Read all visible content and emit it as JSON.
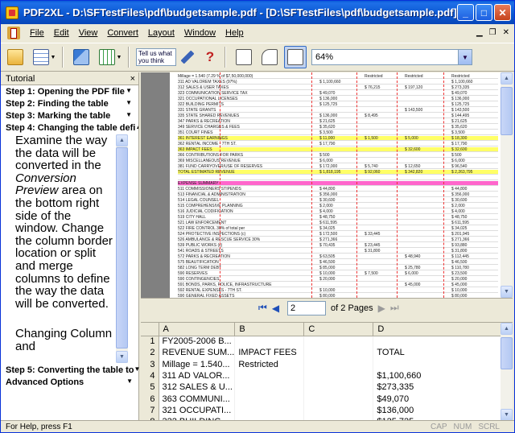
{
  "window": {
    "title": "PDF2XL - D:\\SFTestFiles\\pdf\\budgetsample.pdf - [D:\\SFTestFiles\\pdf\\budgetsample.pdf]"
  },
  "menu": {
    "items": [
      "File",
      "Edit",
      "View",
      "Convert",
      "Layout",
      "Window",
      "Help"
    ]
  },
  "toolbar": {
    "tell_me": "Tell us what you think",
    "zoom": "64%"
  },
  "tutorial": {
    "header": "Tutorial",
    "close": "×",
    "steps_top": [
      "Step 1: Opening the PDF file",
      "Step 2: Finding the table",
      "Step 3: Marking the table",
      "Step 4: Changing the table defi"
    ],
    "body_pre": "Examine the way the data will be converted in the",
    "body_em": "Conversion Preview",
    "body_post": "area on the bottom right side of the window. Change the column border location or split and merge columns to define the way the data will be converted.",
    "subheading": "Changing Column and",
    "steps_bottom": [
      "Step 5: Converting the table to",
      "Advanced Options"
    ]
  },
  "pdf": {
    "rows": [
      {
        "label": "Millage = 1.540 (7.29 % of $7,50,000,000)",
        "v1": "",
        "v2": "Restricted",
        "v3": "Restricted",
        "v4": "Restricted"
      },
      {
        "label": "311 AD VALOREM TAXES (97%)",
        "v1": "$ 1,100,660",
        "v2": "",
        "v3": "",
        "v4": "$ 1,100,660"
      },
      {
        "label": "312 SALES & USER TAXES",
        "v1": "",
        "v2": "$ 76,215",
        "v3": "$ 197,120",
        "v4": "$ 273,335"
      },
      {
        "label": "323 COMMUNICATION SERVICE TAX",
        "v1": "$ 49,070",
        "v2": "",
        "v3": "",
        "v4": "$ 49,070"
      },
      {
        "label": "321 OCCUPATIONAL LICENSES",
        "v1": "$ 136,000",
        "v2": "",
        "v3": "",
        "v4": "$ 136,000"
      },
      {
        "label": "322 BUILDING PERMITS",
        "v1": "$ 125,725",
        "v2": "",
        "v3": "",
        "v4": "$ 125,725"
      },
      {
        "label": "331 STATE GRANTS",
        "v1": "",
        "v2": "",
        "v3": "$ 143,500",
        "v4": "$ 143,500"
      },
      {
        "label": "335 STATE SHARED REVENUES",
        "v1": "$ 136,000",
        "v2": "$ 8,495",
        "v3": "",
        "v4": "$ 144,495"
      },
      {
        "label": "347 PARKS & RECREATION",
        "v1": "$ 21,625",
        "v2": "",
        "v3": "",
        "v4": "$ 21,625"
      },
      {
        "label": "349 SERVICE CHARGES & FEES",
        "v1": "$ 35,620",
        "v2": "",
        "v3": "",
        "v4": "$ 35,620"
      },
      {
        "label": "351 COURT FINES",
        "v1": "$ 3,500",
        "v2": "",
        "v3": "",
        "v4": "$ 3,500"
      },
      {
        "label": "361 INTEREST EARNINGS",
        "v1": "$ 11,000",
        "v2": "$ 1,500",
        "v3": "$ 5,000",
        "v4": "$ 18,300"
      },
      {
        "label": "362 RENTAL INCOME - 7TH ST.",
        "v1": "$ 17,790",
        "v2": "",
        "v3": "",
        "v4": "$ 17,790"
      },
      {
        "label": "363 IMPACT FEES",
        "v1": "",
        "v2": "",
        "v3": "$ 32,600",
        "v4": "$ 32,600"
      },
      {
        "label": "366 CONTRIBUTIONS FOR PARKS",
        "v1": "$ 500",
        "v2": "",
        "v3": "",
        "v4": "$ 500"
      },
      {
        "label": "369 MISCELLANEOUS REVENUE",
        "v1": "$ 6,000",
        "v2": "",
        "v3": "",
        "v4": "$ 6,000"
      },
      {
        "label": "381 FUND CARRYOVER/USE OF RESERVES",
        "v1": "$ 172,000",
        "v2": "$ 5,740",
        "v3": "$ 12,650",
        "v4": "$ 96,540"
      },
      {
        "label": "TOTAL ESTIMATED REVENUE",
        "v1": "$ 1,818,195",
        "v2": "$ 92,060",
        "v3": "$ 342,820",
        "v4": "$ 2,263,795"
      },
      {
        "label": "",
        "v1": "",
        "v2": "",
        "v3": "",
        "v4": ""
      },
      {
        "label": "EXPENSE SUMMARY",
        "v1": "",
        "v2": "",
        "v3": "",
        "v4": ""
      },
      {
        "label": "511 COMMISSIONERS STIPENDS",
        "v1": "$ 44,800",
        "v2": "",
        "v3": "",
        "v4": "$ 44,800"
      },
      {
        "label": "513 FINANCIAL & ADMINISTRATION",
        "v1": "$ 356,000",
        "v2": "",
        "v3": "",
        "v4": "$ 356,000"
      },
      {
        "label": "514 LEGAL COUNSEL",
        "v1": "$ 30,600",
        "v2": "",
        "v3": "",
        "v4": "$ 30,600"
      },
      {
        "label": "515 COMPREHENSIVE PLANNING",
        "v1": "$ 2,000",
        "v2": "",
        "v3": "",
        "v4": "$ 2,000"
      },
      {
        "label": "516 JUDICIAL CODIFICATION",
        "v1": "$ 4,000",
        "v2": "",
        "v3": "",
        "v4": "$ 4,000"
      },
      {
        "label": "519 CITY HALL",
        "v1": "$ 48,750",
        "v2": "",
        "v3": "",
        "v4": "$ 48,750"
      },
      {
        "label": "521 LAW ENFORCEMENT",
        "v1": "$ 611,595",
        "v2": "",
        "v3": "",
        "v4": "$ 611,595"
      },
      {
        "label": "522 FIRE CONTROL 30% of total per",
        "v1": "$ 34,025",
        "v2": "",
        "v3": "",
        "v4": "$ 34,025"
      },
      {
        "label": "524 PROTECTIVE INSPECTIONS (c)",
        "v1": "$ 172,500",
        "v2": "$ 33,445",
        "v3": "",
        "v4": "$ 201,945"
      },
      {
        "label": "526 AMBULANCE & RESCUE SERVICE 30%",
        "v1": "$ 271,366",
        "v2": "",
        "v3": "",
        "v4": "$ 271,366"
      },
      {
        "label": "539 PUBLIC WORKS (c)",
        "v1": "$ 70,435",
        "v2": "$ 23,445",
        "v3": "",
        "v4": "$ 93,880"
      },
      {
        "label": "541 ROADS & STREETS",
        "v1": "",
        "v2": "$ 31,800",
        "v3": "",
        "v4": "$ 31,800"
      },
      {
        "label": "572 PARKS & RECREATION",
        "v1": "$ 63,505",
        "v2": "",
        "v3": "$ 48,940",
        "v4": "$ 112,445"
      },
      {
        "label": "575 BEAUTIFICATION",
        "v1": "$ 46,500",
        "v2": "",
        "v3": "",
        "v4": "$ 46,500"
      },
      {
        "label": "582 LONG TERM DEBT",
        "v1": "$ 85,000",
        "v2": "",
        "v3": "$ 25,780",
        "v4": "$ 110,780"
      },
      {
        "label": "590 RESERVES",
        "v1": "$ 10,000",
        "v2": "$ 7,500",
        "v3": "$ 6,000",
        "v4": "$ 23,500"
      },
      {
        "label": "590 CONTINGENCIES",
        "v1": "$ 20,000",
        "v2": "",
        "v3": "",
        "v4": "$ 20,000"
      },
      {
        "label": "591 BONDS, PARKS, POLICE, INFRASTRUCTURE",
        "v1": "",
        "v2": "",
        "v3": "$ 45,000",
        "v4": "$ 45,000"
      },
      {
        "label": "592 RENTAL EXPENSES - 7TH ST.",
        "v1": "$ 10,000",
        "v2": "",
        "v3": "",
        "v4": "$ 10,000"
      },
      {
        "label": "590 GENERAL FIXED ASSETS",
        "v1": "$ 80,000",
        "v2": "",
        "v3": "",
        "v4": "$ 80,000"
      }
    ]
  },
  "nav": {
    "page": "2",
    "of_pages": "of 2 Pages"
  },
  "grid": {
    "columns": [
      "A",
      "B",
      "C",
      "D"
    ],
    "rows": [
      {
        "n": "1",
        "a": "FY2005-2006 B...",
        "b": "",
        "c": "",
        "d": ""
      },
      {
        "n": "2",
        "a": "REVENUE SUM...",
        "b": "IMPACT FEES",
        "c": "",
        "d": "TOTAL"
      },
      {
        "n": "3",
        "a": "Millage = 1.540...",
        "b": "Restricted",
        "c": "",
        "d": ""
      },
      {
        "n": "4",
        "a": "311 AD VALOR...",
        "b": "",
        "c": "",
        "d": "$1,100,660"
      },
      {
        "n": "5",
        "a": "312 SALES & U...",
        "b": "",
        "c": "",
        "d": "$273,335"
      },
      {
        "n": "6",
        "a": "363 COMMUNI...",
        "b": "",
        "c": "",
        "d": "$49,070"
      },
      {
        "n": "7",
        "a": "321 OCCUPATI...",
        "b": "",
        "c": "",
        "d": "$136,000"
      },
      {
        "n": "8",
        "a": "322 BUILDING ...",
        "b": "",
        "c": "",
        "d": "$125,725"
      }
    ]
  },
  "status": {
    "message": "For Help, press F1",
    "keys": [
      "CAP",
      "NUM",
      "SCRL"
    ]
  }
}
